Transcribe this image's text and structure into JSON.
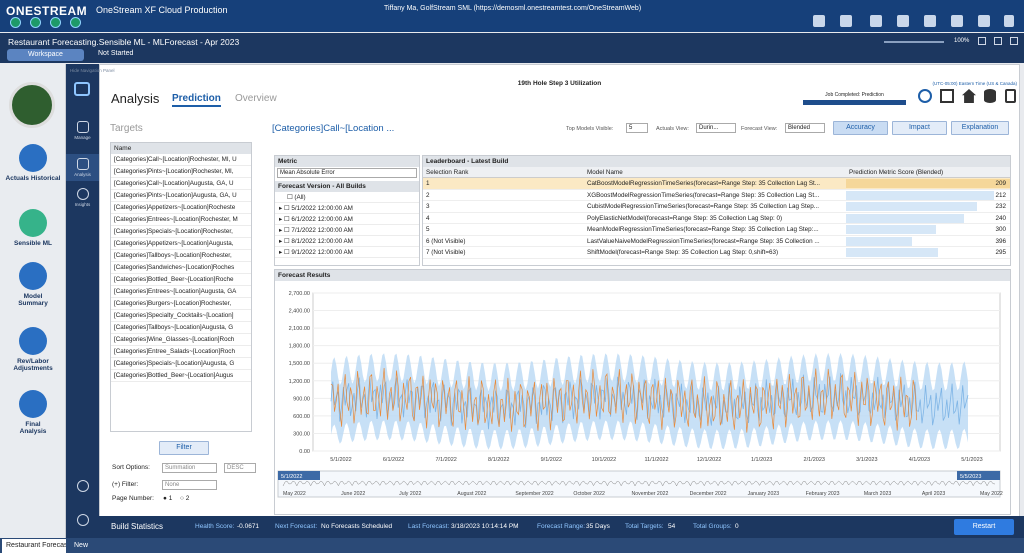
{
  "app": {
    "logo": "ONESTREAM",
    "title": "OneStream XF Cloud Production",
    "user": "Tiffany Ma, GolfStream SML (https://demosml.onestreamtest.com/OneStreamWeb)"
  },
  "workbar": {
    "crumb": "Restaurant Forecasting.Sensible ML  -  MLForecast  -  Apr 2023",
    "workspace_label": "Workspace",
    "status": "Not Started",
    "zoom": "100%"
  },
  "leftnav": {
    "items": [
      {
        "label": "Actuals Historical"
      },
      {
        "label": "Sensible ML"
      },
      {
        "label": "Model Summary"
      },
      {
        "label": "Rev/Labor Adjustments"
      },
      {
        "label": "Final Analysis"
      }
    ]
  },
  "sidebar2": {
    "items": [
      {
        "label": "Manage"
      },
      {
        "label": "Analysis"
      },
      {
        "label": "Insights"
      }
    ]
  },
  "header": {
    "hide_nav": "Hide Navigation Panel",
    "page_title": "19th Hole Step 3 Utilization",
    "timezone": "(UTC-05:00) Eastern Time (US & Canada)",
    "job": "Job Completed: Prediction"
  },
  "tabs": {
    "analysis": "Analysis",
    "prediction": "Prediction",
    "overview": "Overview"
  },
  "targets": {
    "title": "Targets",
    "col": "Name",
    "items": [
      "[Categories]Call~[Location]Rochester, MI, U",
      "[Categories]Pints~[Location]Rochester, MI,",
      "[Categories]Call~[Location]Augusta, GA, U",
      "[Categories]Pints~[Location]Augusta, GA, U",
      "[Categories]Appetizers~[Location]Rocheste",
      "[Categories]Entrees~[Location]Rochester, M",
      "[Categories]Specials~[Location]Rochester,",
      "[Categories]Appetizers~[Location]Augusta,",
      "[Categories]Tallboys~[Location]Rochester,",
      "[Categories]Sandwiches~[Location]Roches",
      "[Categories]Bottled_Beer~[Location]Roche",
      "[Categories]Entrees~[Location]Augusta, GA",
      "[Categories]Burgers~[Location]Rochester,",
      "[Categories]Specialty_Cocktails~[Location]",
      "[Categories]Tallboys~[Location]Augusta, G",
      "[Categories]Wine_Glasses~[Location]Roch",
      "[Categories]Entree_Salads~[Location]Roch",
      "[Categories]Specials~[Location]Augusta, G",
      "[Categories]Bottled_Beer~[Location]Augus"
    ],
    "filter_btn": "Filter",
    "sort_label": "Sort Options:",
    "sort_value": "Summation",
    "sort_dir": "DESC",
    "filter_label": "(+) Filter:",
    "filter_value": "None",
    "page_label": "Page Number:",
    "page1": "1",
    "page2": "2"
  },
  "detail": {
    "title": "[Categories]Call~[Location ...",
    "top_models_label": "Top Models Visible:",
    "top_models_value": "5",
    "actuals_label": "Actuals View:",
    "actuals_value": "Durin...",
    "forecast_view_label": "Forecast View:",
    "forecast_view_value": "Blended",
    "accuracy": "Accuracy",
    "impact": "Impact",
    "explanation": "Explanation"
  },
  "metric": {
    "title": "Metric",
    "value": "Mean Absolute Error",
    "fv_title": "Forecast Version - All Builds",
    "versions": [
      "(All)",
      "5/1/2022 12:00:00 AM",
      "6/1/2022 12:00:00 AM",
      "7/1/2022 12:00:00 AM",
      "8/1/2022 12:00:00 AM",
      "9/1/2022 12:00:00 AM"
    ]
  },
  "leaderboard": {
    "title": "Leaderboard - Latest Build",
    "cols": [
      "Selection Rank",
      "Model Name",
      "Prediction Metric Score (Blended)"
    ],
    "rows": [
      {
        "rank": "1",
        "model": "CatBoostModelRegressionTimeSeries(forecast=Range Step: 35  Collection Lag St...",
        "score": "209",
        "frac": 1.0
      },
      {
        "rank": "2",
        "model": "XGBoostModelRegressionTimeSeries(forecast=Range Step: 35  Collection Lag St...",
        "score": "212",
        "frac": 0.9
      },
      {
        "rank": "3",
        "model": "CubistModelRegressionTimeSeries(forecast=Range Step: 35  Collection Lag Step...",
        "score": "232",
        "frac": 0.8
      },
      {
        "rank": "4",
        "model": "PolyElasticNetModel(forecast=Range Step: 35  Collection Lag Step: 0)",
        "score": "240",
        "frac": 0.72
      },
      {
        "rank": "5",
        "model": "MeanModelRegressionTimeSeries(forecast=Range Step: 35  Collection Lag Step:...",
        "score": "300",
        "frac": 0.55
      },
      {
        "rank": "6 (Not Visible)",
        "model": "LastValueNaiveModelRegressionTimeSeries(forecast=Range Step: 35  Collection ...",
        "score": "396",
        "frac": 0.4
      },
      {
        "rank": "7 (Not Visible)",
        "model": "ShiftModel(forecast=Range Step: 35  Collection Lag Step: 0,shift=63)",
        "score": "295",
        "frac": 0.56
      }
    ]
  },
  "forecast": {
    "title": "Forecast Results"
  },
  "chart_data": {
    "type": "line",
    "x_ticks": [
      "5/1/2022",
      "6/1/2022",
      "7/1/2022",
      "8/1/2022",
      "9/1/2022",
      "10/1/2022",
      "11/1/2022",
      "12/1/2022",
      "1/1/2023",
      "2/1/2023",
      "3/1/2023",
      "4/1/2023",
      "5/1/2023"
    ],
    "y_ticks": [
      "2,700.00",
      "2,400.00",
      "2,100.00",
      "1,800.00",
      "1,500.00",
      "1,200.00",
      "900.00",
      "600.00",
      "300.00",
      "0.00"
    ],
    "ylim": [
      0,
      2700
    ],
    "nav_ticks": [
      "May 2022",
      "June 2022",
      "July 2022",
      "August 2022",
      "September 2022",
      "October 2022",
      "November 2022",
      "December 2022",
      "January 2023",
      "February 2023",
      "March 2023",
      "April 2023",
      "May 2022"
    ],
    "nav_start": "5/1/2022",
    "nav_end": "5/5/2023",
    "colors": {
      "actual": "#e88a3a",
      "forecast": "#7fb5e6",
      "band": "#b9d8f4"
    }
  },
  "footer": {
    "build_stats": "Build Statistics",
    "health_label": "Health Score:",
    "health": "-0.0671",
    "next_label": "Next Forecast:",
    "next": "No Forecasts Scheduled",
    "last_label": "Last Forecast:",
    "last": "3/18/2023 10:14:14 PM",
    "range_label": "Forecast Range:",
    "range": "35 Days",
    "tt_label": "Total Targets:",
    "tt": "54",
    "tg_label": "Total Groups:",
    "tg": "0",
    "restart": "Restart"
  },
  "bottomtabs": {
    "tab1": "Restaurant Forecas",
    "tab2": "New"
  }
}
